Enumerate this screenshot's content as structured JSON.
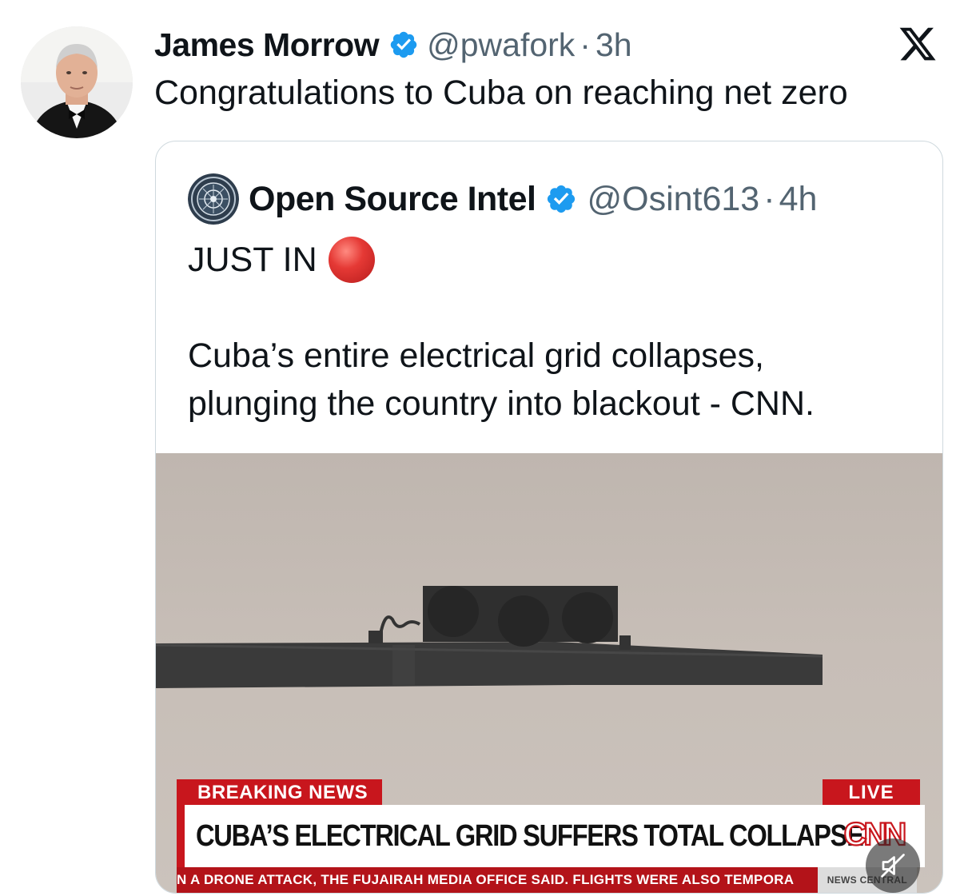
{
  "tweet": {
    "author_name": "James Morrow",
    "handle": "@pwafork",
    "separator": "·",
    "time": "3h",
    "text": "Congratulations to Cuba on reaching net zero",
    "verified_color": "#1d9bf0"
  },
  "quoted_tweet": {
    "author_name": "Open Source Intel",
    "handle": "@Osint613",
    "separator": "·",
    "time": "4h",
    "text_line1": "JUST IN",
    "text_line2": "Cuba’s entire electrical grid collapses,",
    "text_line3": "plunging the country into blackout - CNN."
  },
  "media": {
    "breaking_label": "BREAKING NEWS",
    "live_label": "LIVE",
    "headline": "CUBA’S ELECTRICAL GRID SUFFERS TOTAL COLLAPSE",
    "network_logo": "CNN",
    "ticker": "N A DRONE ATTACK, THE FUJAIRAH MEDIA OFFICE SAID. FLIGHTS WERE ALSO TEMPORA",
    "ticker_brand": "NEWS CENTRAL",
    "accent_color": "#c8161d"
  },
  "icons": {
    "platform_logo": "x-logo-icon",
    "verified": "verified-badge-icon",
    "emoji": "red-circle-emoji",
    "mute": "sound-off-icon"
  }
}
